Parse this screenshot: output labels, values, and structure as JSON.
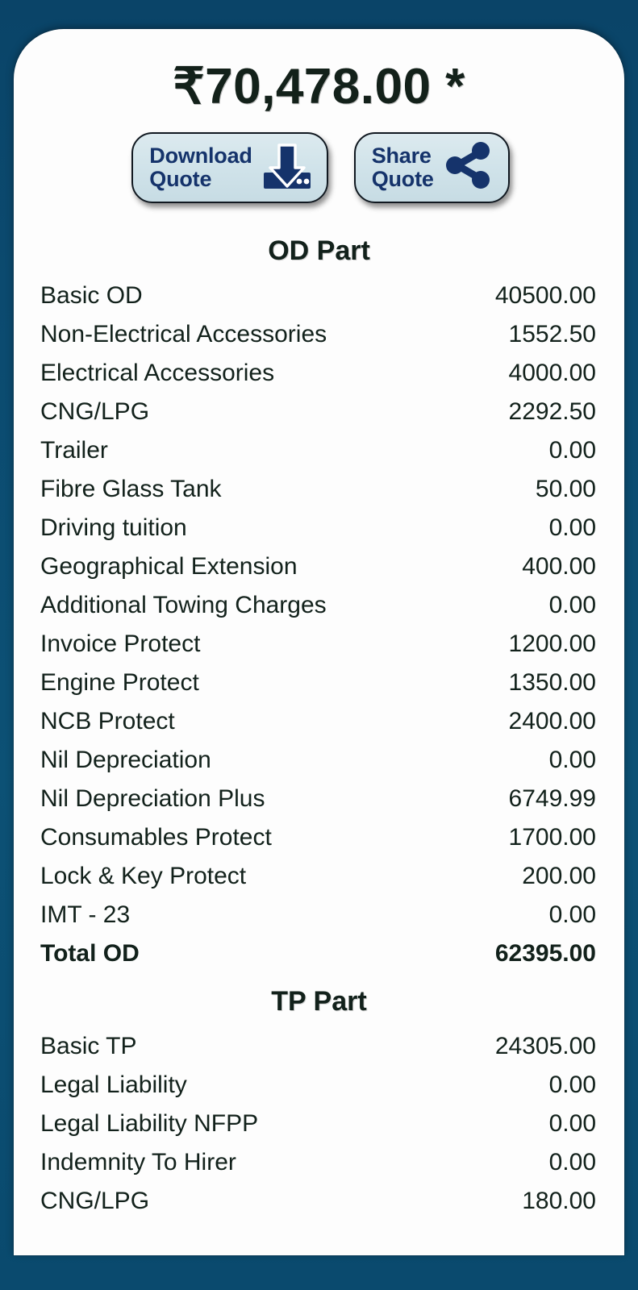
{
  "theme": {
    "background_color": "#0b4a6f",
    "card_color": "#fdfdfd",
    "text_color": "#12211b",
    "button_fill": "#cfe2e9",
    "button_accent": "#15336b"
  },
  "header": {
    "amount": "₹70,478.00 *"
  },
  "actions": [
    {
      "label": "Download\nQuote",
      "icon": "download-icon",
      "name": "download-quote-button"
    },
    {
      "label": "Share\nQuote",
      "icon": "share-icon",
      "name": "share-quote-button"
    }
  ],
  "sections": [
    {
      "title": "OD Part",
      "rows": [
        {
          "label": "Basic OD",
          "value": "40500.00",
          "total": false
        },
        {
          "label": "Non-Electrical Accessories",
          "value": "1552.50",
          "total": false
        },
        {
          "label": "Electrical Accessories",
          "value": "4000.00",
          "total": false
        },
        {
          "label": "CNG/LPG",
          "value": "2292.50",
          "total": false
        },
        {
          "label": "Trailer",
          "value": "0.00",
          "total": false
        },
        {
          "label": "Fibre Glass Tank",
          "value": "50.00",
          "total": false
        },
        {
          "label": "Driving tuition",
          "value": "0.00",
          "total": false
        },
        {
          "label": "Geographical Extension",
          "value": "400.00",
          "total": false
        },
        {
          "label": "Additional Towing Charges",
          "value": "0.00",
          "total": false
        },
        {
          "label": "Invoice Protect",
          "value": "1200.00",
          "total": false
        },
        {
          "label": "Engine Protect",
          "value": "1350.00",
          "total": false
        },
        {
          "label": "NCB Protect",
          "value": "2400.00",
          "total": false
        },
        {
          "label": "Nil Depreciation",
          "value": "0.00",
          "total": false
        },
        {
          "label": "Nil Depreciation Plus",
          "value": "6749.99",
          "total": false
        },
        {
          "label": "Consumables Protect",
          "value": "1700.00",
          "total": false
        },
        {
          "label": "Lock & Key Protect",
          "value": "200.00",
          "total": false
        },
        {
          "label": "IMT - 23",
          "value": "0.00",
          "total": false
        },
        {
          "label": "Total OD",
          "value": "62395.00",
          "total": true
        }
      ]
    },
    {
      "title": "TP Part",
      "rows": [
        {
          "label": "Basic TP",
          "value": "24305.00",
          "total": false
        },
        {
          "label": "Legal Liability",
          "value": "0.00",
          "total": false
        },
        {
          "label": "Legal Liability NFPP",
          "value": "0.00",
          "total": false
        },
        {
          "label": "Indemnity To Hirer",
          "value": "0.00",
          "total": false
        },
        {
          "label": "CNG/LPG",
          "value": "180.00",
          "total": false
        }
      ]
    }
  ]
}
